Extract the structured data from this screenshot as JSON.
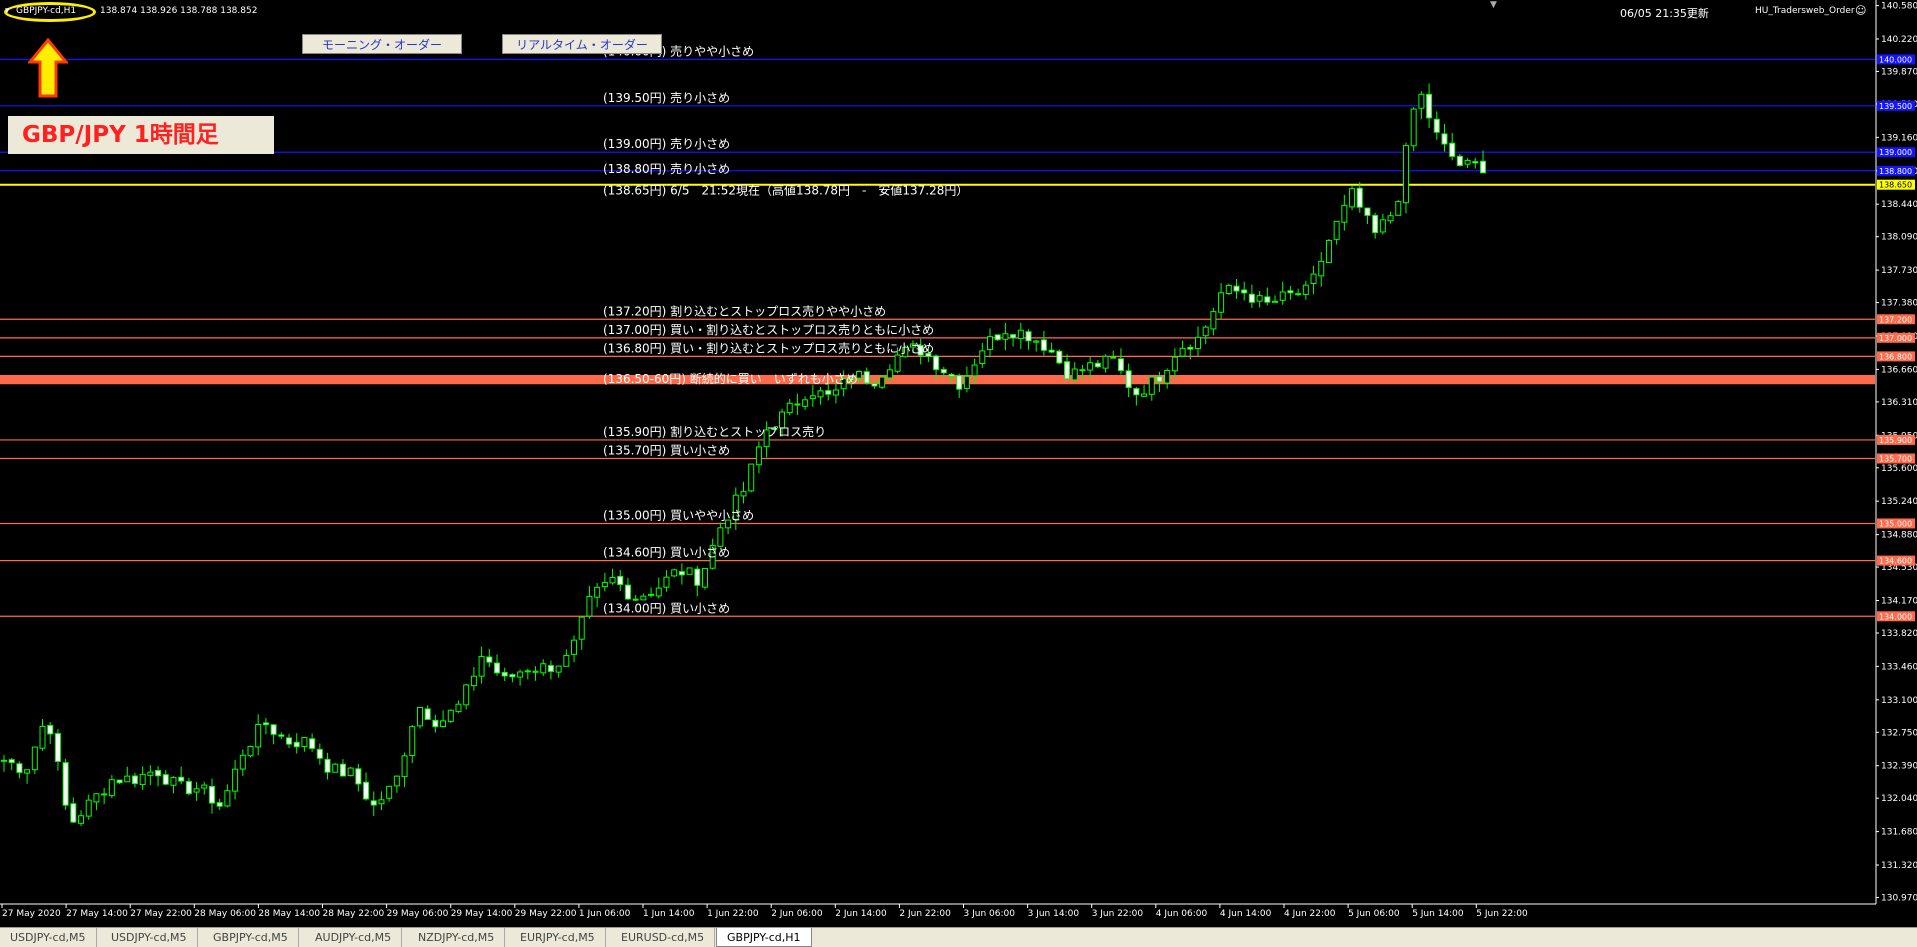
{
  "header": {
    "symbol_tf": "GBPJPY-cd,H1",
    "ohlc": "138.874 138.926 138.788 138.852",
    "updated": "06/05 21:35更新",
    "indicator_name": "HU_Tradersweb_Order"
  },
  "panel": {
    "morning_button": "モーニング・オーダー",
    "realtime_button": "リアルタイム・オーダー",
    "pair_title": "GBP/JPY 1時間足"
  },
  "colors": {
    "candle": "#00ff00",
    "candle_body_up": "#000000",
    "candle_body_down": "#ffffff",
    "sell_line": "#1414ff",
    "buy_line": "#ff6a4a",
    "current_line": "#ffff00",
    "zone_band": "#ff6a4a",
    "background": "#000000"
  },
  "orders": [
    {
      "price": 140.0,
      "text": "(140.00円) 売りやや小さめ",
      "side": "sell",
      "tag": "140.000"
    },
    {
      "price": 139.5,
      "text": "(139.50円) 売り小さめ",
      "side": "sell",
      "tag": "139.500"
    },
    {
      "price": 139.0,
      "text": "(139.00円) 売り小さめ",
      "side": "sell",
      "tag": "139.000"
    },
    {
      "price": 138.8,
      "text": "(138.80円) 売り小さめ",
      "side": "sell",
      "tag": "138.800"
    },
    {
      "price": 138.65,
      "text": "(138.65円) 6/5　21:52現在（高値138.78円　-　安値137.28円）",
      "side": "current",
      "tag": "138.650"
    },
    {
      "price": 137.2,
      "text": "(137.20円) 割り込むとストップロス売りやや小さめ",
      "side": "buy",
      "tag": "137.200"
    },
    {
      "price": 137.0,
      "text": "(137.00円) 買い・割り込むとストップロス売りともに小さめ",
      "side": "buy",
      "tag": "137.000"
    },
    {
      "price": 136.8,
      "text": "(136.80円) 買い・割り込むとストップロス売りともに小さめ",
      "side": "buy",
      "tag": "136.800"
    },
    {
      "price": 135.9,
      "text": "(135.90円) 割り込むとストップロス売り",
      "side": "buy",
      "tag": "135.900"
    },
    {
      "price": 135.7,
      "text": "(135.70円) 買い小さめ",
      "side": "buy",
      "tag": "135.700"
    },
    {
      "price": 135.0,
      "text": "(135.00円) 買いやや小さめ",
      "side": "buy",
      "tag": "135.000"
    },
    {
      "price": 134.6,
      "text": "(134.60円) 買い小さめ",
      "side": "buy",
      "tag": "134.600"
    },
    {
      "price": 134.0,
      "text": "(134.00円) 買い小さめ",
      "side": "buy",
      "tag": "134.000"
    }
  ],
  "zone": {
    "from": 136.5,
    "to": 136.6,
    "text": "(136.50-60円) 断続的に買い　いずれも小さめ"
  },
  "chart_data": {
    "type": "candlestick",
    "ylim": [
      130.9,
      140.64
    ],
    "y_ticks": [
      "140.580",
      "140.220",
      "139.870",
      "139.520",
      "139.160",
      "138.800",
      "138.440",
      "138.090",
      "137.730",
      "137.380",
      "137.020",
      "136.660",
      "136.310",
      "135.950",
      "135.600",
      "135.240",
      "134.880",
      "134.530",
      "134.170",
      "133.820",
      "133.460",
      "133.100",
      "132.750",
      "132.390",
      "132.040",
      "131.680",
      "131.320",
      "130.970"
    ],
    "x_labels": [
      "27 May 2020",
      "27 May 14:00",
      "27 May 22:00",
      "28 May 06:00",
      "28 May 14:00",
      "28 May 22:00",
      "29 May 06:00",
      "29 May 14:00",
      "29 May 22:00",
      "1 Jun 06:00",
      "1 Jun 14:00",
      "1 Jun 22:00",
      "2 Jun 06:00",
      "2 Jun 14:00",
      "2 Jun 22:00",
      "3 Jun 06:00",
      "3 Jun 14:00",
      "3 Jun 22:00",
      "4 Jun 06:00",
      "4 Jun 14:00",
      "4 Jun 22:00",
      "5 Jun 06:00",
      "5 Jun 14:00",
      "5 Jun 22:00"
    ],
    "anchors": [
      132.45,
      132.35,
      132.95,
      131.75,
      132.0,
      132.25,
      132.25,
      132.35,
      132.15,
      132.15,
      131.95,
      132.55,
      132.85,
      132.65,
      132.65,
      132.35,
      132.3,
      131.95,
      132.2,
      133.05,
      132.85,
      133.05,
      133.6,
      133.3,
      133.45,
      133.45,
      133.55,
      134.2,
      134.4,
      134.2,
      134.3,
      134.5,
      134.4,
      135.0,
      135.35,
      136.0,
      136.2,
      136.45,
      136.35,
      136.6,
      136.55,
      136.8,
      136.9,
      136.7,
      136.5,
      136.9,
      137.1,
      137.05,
      136.9,
      136.6,
      136.7,
      136.75,
      136.4,
      136.55,
      136.9,
      137.0,
      137.5,
      137.5,
      137.35,
      137.45,
      137.5,
      138.1,
      138.55,
      138.1,
      138.4,
      139.7,
      139.1,
      138.85,
      138.85
    ],
    "total_bars": 193,
    "seed": 7
  },
  "tabs": [
    "USDJPY-cd,M5",
    "USDJPY-cd,M5",
    "GBPJPY-cd,M5",
    "AUDJPY-cd,M5",
    "NZDJPY-cd,M5",
    "EURJPY-cd,M5",
    "EURUSD-cd,M5",
    "GBPJPY-cd,H1"
  ],
  "active_tab": 7
}
